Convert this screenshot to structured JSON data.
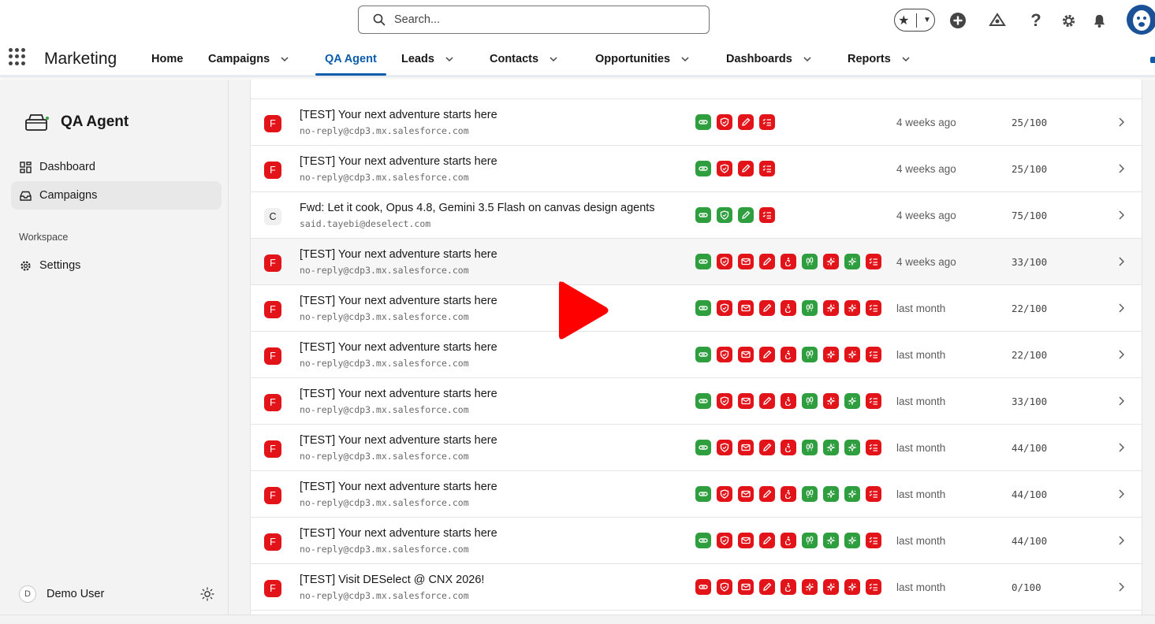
{
  "search": {
    "placeholder": "Search..."
  },
  "app": {
    "name": "Marketing"
  },
  "nav": {
    "items": [
      {
        "label": "Home",
        "dropdown": false,
        "active": false
      },
      {
        "label": "Campaigns",
        "dropdown": true,
        "active": false
      },
      {
        "label": "QA Agent",
        "dropdown": false,
        "active": true
      },
      {
        "label": "Leads",
        "dropdown": true,
        "active": false
      },
      {
        "label": "Contacts",
        "dropdown": true,
        "active": false
      },
      {
        "label": "Opportunities",
        "dropdown": true,
        "active": false
      },
      {
        "label": "Dashboards",
        "dropdown": true,
        "active": false
      },
      {
        "label": "Reports",
        "dropdown": true,
        "active": false
      }
    ]
  },
  "utility_icons": [
    "favorites-star-icon",
    "add-icon",
    "setup-assistant-icon",
    "help-icon",
    "settings-gear-icon",
    "notifications-bell-icon",
    "user-avatar-icon"
  ],
  "sidebar": {
    "brand": "QA Agent",
    "items": [
      {
        "label": "Dashboard",
        "icon": "dashboard-icon",
        "active": false
      },
      {
        "label": "Campaigns",
        "icon": "inbox-icon",
        "active": true
      }
    ],
    "section_label": "Workspace",
    "settings_label": "Settings",
    "user": {
      "initial": "D",
      "name": "Demo User"
    }
  },
  "colors": {
    "accent": "#0b5cab",
    "pass": "#2e9e3e",
    "fail": "#e2141a"
  },
  "check_icons": [
    "link-icon",
    "shield-icon",
    "mail-icon",
    "pencil-icon",
    "accessibility-icon",
    "footprints-icon",
    "sparkles-icon",
    "sparkles-icon",
    "checklist-icon"
  ],
  "campaigns": [
    {
      "badge": "F",
      "subject": "[TEST] Your next adventure starts here",
      "sender": "no-reply@cdp3.mx.salesforce.com",
      "checks": [
        "pass",
        "fail",
        "fail",
        "fail"
      ],
      "check_icons": [
        0,
        1,
        3,
        8
      ],
      "when": "4 weeks ago",
      "score": "25/100"
    },
    {
      "badge": "F",
      "subject": "[TEST] Your next adventure starts here",
      "sender": "no-reply@cdp3.mx.salesforce.com",
      "checks": [
        "pass",
        "fail",
        "fail",
        "fail"
      ],
      "check_icons": [
        0,
        1,
        3,
        8
      ],
      "when": "4 weeks ago",
      "score": "25/100"
    },
    {
      "badge": "C",
      "subject": "Fwd: Let it cook, Opus 4.8, Gemini 3.5 Flash on canvas design agents",
      "sender": "said.tayebi@deselect.com",
      "checks": [
        "pass",
        "pass",
        "pass",
        "fail"
      ],
      "check_icons": [
        0,
        1,
        3,
        8
      ],
      "when": "4 weeks ago",
      "score": "75/100"
    },
    {
      "badge": "F",
      "subject": "[TEST] Your next adventure starts here",
      "sender": "no-reply@cdp3.mx.salesforce.com",
      "checks": [
        "pass",
        "fail",
        "fail",
        "fail",
        "fail",
        "pass",
        "fail",
        "pass",
        "fail"
      ],
      "check_icons": [
        0,
        1,
        2,
        3,
        4,
        5,
        6,
        7,
        8
      ],
      "when": "4 weeks ago",
      "score": "33/100"
    },
    {
      "badge": "F",
      "subject": "[TEST] Your next adventure starts here",
      "sender": "no-reply@cdp3.mx.salesforce.com",
      "checks": [
        "pass",
        "fail",
        "fail",
        "fail",
        "fail",
        "pass",
        "fail",
        "fail",
        "fail"
      ],
      "check_icons": [
        0,
        1,
        2,
        3,
        4,
        5,
        6,
        7,
        8
      ],
      "when": "last month",
      "score": "22/100"
    },
    {
      "badge": "F",
      "subject": "[TEST] Your next adventure starts here",
      "sender": "no-reply@cdp3.mx.salesforce.com",
      "checks": [
        "pass",
        "fail",
        "fail",
        "fail",
        "fail",
        "pass",
        "fail",
        "fail",
        "fail"
      ],
      "check_icons": [
        0,
        1,
        2,
        3,
        4,
        5,
        6,
        7,
        8
      ],
      "when": "last month",
      "score": "22/100"
    },
    {
      "badge": "F",
      "subject": "[TEST] Your next adventure starts here",
      "sender": "no-reply@cdp3.mx.salesforce.com",
      "checks": [
        "pass",
        "fail",
        "fail",
        "fail",
        "fail",
        "pass",
        "fail",
        "pass",
        "fail"
      ],
      "check_icons": [
        0,
        1,
        2,
        3,
        4,
        5,
        6,
        7,
        8
      ],
      "when": "last month",
      "score": "33/100"
    },
    {
      "badge": "F",
      "subject": "[TEST] Your next adventure starts here",
      "sender": "no-reply@cdp3.mx.salesforce.com",
      "checks": [
        "pass",
        "fail",
        "fail",
        "fail",
        "fail",
        "pass",
        "pass",
        "pass",
        "fail"
      ],
      "check_icons": [
        0,
        1,
        2,
        3,
        4,
        5,
        6,
        7,
        8
      ],
      "when": "last month",
      "score": "44/100"
    },
    {
      "badge": "F",
      "subject": "[TEST] Your next adventure starts here",
      "sender": "no-reply@cdp3.mx.salesforce.com",
      "checks": [
        "pass",
        "fail",
        "fail",
        "fail",
        "fail",
        "pass",
        "pass",
        "pass",
        "fail"
      ],
      "check_icons": [
        0,
        1,
        2,
        3,
        4,
        5,
        6,
        7,
        8
      ],
      "when": "last month",
      "score": "44/100"
    },
    {
      "badge": "F",
      "subject": "[TEST] Your next adventure starts here",
      "sender": "no-reply@cdp3.mx.salesforce.com",
      "checks": [
        "pass",
        "fail",
        "fail",
        "fail",
        "fail",
        "pass",
        "pass",
        "pass",
        "fail"
      ],
      "check_icons": [
        0,
        1,
        2,
        3,
        4,
        5,
        6,
        7,
        8
      ],
      "when": "last month",
      "score": "44/100"
    },
    {
      "badge": "F",
      "subject": "[TEST] Visit DESelect @ CNX 2026!",
      "sender": "no-reply@cdp3.mx.salesforce.com",
      "checks": [
        "fail",
        "fail",
        "fail",
        "fail",
        "fail",
        "fail",
        "fail",
        "fail",
        "fail"
      ],
      "check_icons": [
        0,
        1,
        2,
        3,
        4,
        6,
        6,
        7,
        8
      ],
      "when": "last month",
      "score": "0/100"
    }
  ]
}
